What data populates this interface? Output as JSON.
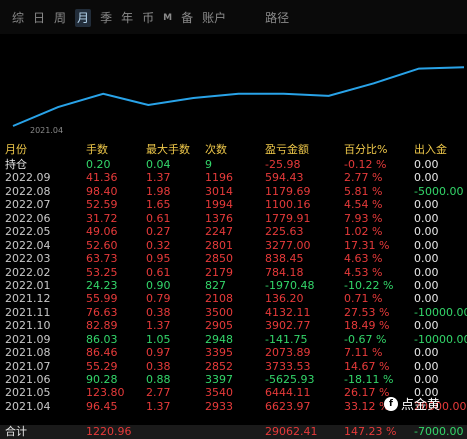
{
  "tabs": [
    {
      "label": "综"
    },
    {
      "label": "日"
    },
    {
      "label": "周"
    },
    {
      "label": "月",
      "active": true
    },
    {
      "label": "季"
    },
    {
      "label": "年"
    },
    {
      "label": "币"
    },
    {
      "label": "M",
      "small": true
    },
    {
      "label": "备"
    },
    {
      "label": "账户"
    }
  ],
  "path_label": "路径",
  "chart": {
    "line_color": "#29a3e8",
    "x_start_label": "2021.04",
    "points": [
      0,
      0.27,
      0.46,
      0.3,
      0.4,
      0.46,
      0.46,
      0.43,
      0.61,
      0.82,
      0.84
    ]
  },
  "header": [
    "月份",
    "手数",
    "最大手数",
    "次数",
    "盈亏金额",
    "百分比%",
    "出入金"
  ],
  "position": {
    "label": "持仓",
    "lots": "0.20",
    "max": "0.04",
    "count": "9",
    "pnl": "-25.98",
    "pct": "-0.12 %",
    "flow": "0.00"
  },
  "rows": [
    {
      "m": "2022.09",
      "lots": "41.36",
      "max": "1.37",
      "count": "1196",
      "pnl": "594.43",
      "pct": "2.77 %",
      "flow": "0.00",
      "dir": "up"
    },
    {
      "m": "2022.08",
      "lots": "98.40",
      "max": "1.98",
      "count": "3014",
      "pnl": "1179.69",
      "pct": "5.81 %",
      "flow": "-5000.00",
      "dir": "up",
      "fdir": "down"
    },
    {
      "m": "2022.07",
      "lots": "52.59",
      "max": "1.65",
      "count": "1994",
      "pnl": "1100.16",
      "pct": "4.54 %",
      "flow": "0.00",
      "dir": "up"
    },
    {
      "m": "2022.06",
      "lots": "31.72",
      "max": "0.61",
      "count": "1376",
      "pnl": "1779.91",
      "pct": "7.93 %",
      "flow": "0.00",
      "dir": "up"
    },
    {
      "m": "2022.05",
      "lots": "49.06",
      "max": "0.27",
      "count": "2247",
      "pnl": "225.63",
      "pct": "1.02 %",
      "flow": "0.00",
      "dir": "up"
    },
    {
      "m": "2022.04",
      "lots": "52.60",
      "max": "0.32",
      "count": "2801",
      "pnl": "3277.00",
      "pct": "17.31 %",
      "flow": "0.00",
      "dir": "up"
    },
    {
      "m": "2022.03",
      "lots": "63.73",
      "max": "0.95",
      "count": "2850",
      "pnl": "838.45",
      "pct": "4.63 %",
      "flow": "0.00",
      "dir": "up"
    },
    {
      "m": "2022.02",
      "lots": "53.25",
      "max": "0.61",
      "count": "2179",
      "pnl": "784.18",
      "pct": "4.53 %",
      "flow": "0.00",
      "dir": "up"
    },
    {
      "m": "2022.01",
      "lots": "24.23",
      "max": "0.90",
      "count": "827",
      "pnl": "-1970.48",
      "pct": "-10.22 %",
      "flow": "0.00",
      "dir": "down"
    },
    {
      "m": "2021.12",
      "lots": "55.99",
      "max": "0.79",
      "count": "2108",
      "pnl": "136.20",
      "pct": "0.71 %",
      "flow": "0.00",
      "dir": "up"
    },
    {
      "m": "2021.11",
      "lots": "76.63",
      "max": "0.38",
      "count": "3500",
      "pnl": "4132.11",
      "pct": "27.53 %",
      "flow": "-10000.00",
      "dir": "up",
      "fdir": "down"
    },
    {
      "m": "2021.10",
      "lots": "82.89",
      "max": "1.37",
      "count": "2905",
      "pnl": "3902.77",
      "pct": "18.49 %",
      "flow": "0.00",
      "dir": "up"
    },
    {
      "m": "2021.09",
      "lots": "86.03",
      "max": "1.05",
      "count": "2948",
      "pnl": "-141.75",
      "pct": "-0.67 %",
      "flow": "-10000.00",
      "dir": "down",
      "fdir": "down"
    },
    {
      "m": "2021.08",
      "lots": "86.46",
      "max": "0.97",
      "count": "3395",
      "pnl": "2073.89",
      "pct": "7.11 %",
      "flow": "0.00",
      "dir": "up"
    },
    {
      "m": "2021.07",
      "lots": "55.29",
      "max": "0.38",
      "count": "2852",
      "pnl": "3733.53",
      "pct": "14.67 %",
      "flow": "0.00",
      "dir": "up"
    },
    {
      "m": "2021.06",
      "lots": "90.28",
      "max": "0.88",
      "count": "3397",
      "pnl": "-5625.93",
      "pct": "-18.11 %",
      "flow": "0.00",
      "dir": "down"
    },
    {
      "m": "2021.05",
      "lots": "123.80",
      "max": "2.77",
      "count": "3540",
      "pnl": "6444.11",
      "pct": "26.17 %",
      "flow": "0.00",
      "dir": "up"
    },
    {
      "m": "2021.04",
      "lots": "96.45",
      "max": "1.37",
      "count": "2933",
      "pnl": "6623.97",
      "pct": "33.12 %",
      "flow": "20000.00",
      "dir": "up",
      "fdir": "up"
    }
  ],
  "total": {
    "label": "合计",
    "lots": "1220.96",
    "pnl": "29062.41",
    "pct": "147.23 %",
    "flow": "-7000.00"
  },
  "watermark": {
    "icon": "f",
    "text": "点金黄"
  }
}
